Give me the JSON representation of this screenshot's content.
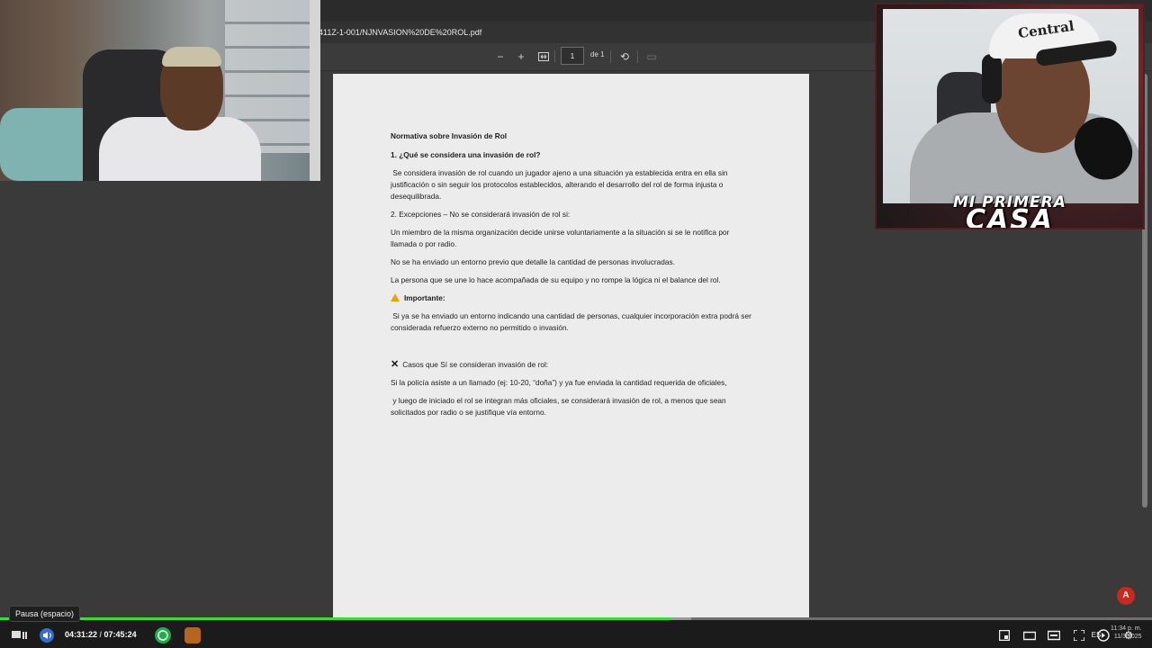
{
  "pdf": {
    "filename": "411Z-1-001/NJNVASION%20DE%20ROL.pdf",
    "page_current": "1",
    "page_total_label": "de 1"
  },
  "document": {
    "title": "Normativa sobre Invasión de Rol",
    "section1_heading": "1. ¿Qué se considera una invasión de rol?",
    "section1_body": "Se considera invasión de rol cuando un jugador ajeno a una situación ya establecida entra en ella sin justificación o sin seguir los protocolos establecidos, alterando el desarrollo del rol de forma injusta o desequilibrada.",
    "section2_heading": "2. Excepciones – No se considerará invasión de rol si:",
    "exception1": "Un miembro de la misma organización decide unirse voluntariamente a la situación  si se le notifica por llamada o por radio.",
    "exception2": "No se ha enviado un entorno previo que detalle la cantidad de personas involucradas.",
    "exception3": "La persona que se une lo hace acompañada de su equipo y no rompe la lógica ni el balance del rol.",
    "important_label": "Importante:",
    "important_body": "Si ya se ha enviado un entorno indicando una cantidad de personas, cualquier incorporación extra podrá ser considerada refuerzo externo no permitido o invasión.",
    "cases_heading": "Casos que Sí se consideran invasión de rol:",
    "case1": "Si la policía asiste a un llamado (ej: 10-20, “doña”) y ya fue enviada la cantidad requerida de oficiales,",
    "case2": "y luego de iniciado el rol se integran más oficiales, se considerará invasión de rol, a menos que sean solicitados por radio o se justifique vía entorno."
  },
  "overlay": {
    "cap_text": "Central",
    "logo_line1": "MI PRIMERA",
    "logo_line2": "CASA"
  },
  "player": {
    "tooltip": "Pausa (espacio)",
    "time_current": "04:31:22",
    "time_separator": " / ",
    "time_total": "07:45:24",
    "progress_fraction": 0.583,
    "buffer_fraction": 0.6,
    "clock_time": "11:34 p. m.",
    "clock_date": "11/3/2025",
    "lang": "ES"
  },
  "colors": {
    "progress": "#3ddc33",
    "acrobat": "#c7281f"
  },
  "icons": {
    "zoom_out": "minus-icon",
    "zoom_in": "plus-icon",
    "fit": "fit-page-icon",
    "rotate": "rotate-icon",
    "present": "present-icon",
    "warning": "warning-icon",
    "cross": "cross-icon",
    "acrobat": "acrobat-icon",
    "play": "play-pause-icon",
    "volume": "volume-icon",
    "whatsapp": "whatsapp-icon",
    "settings": "gear-icon",
    "fullscreen": "fullscreen-icon"
  }
}
